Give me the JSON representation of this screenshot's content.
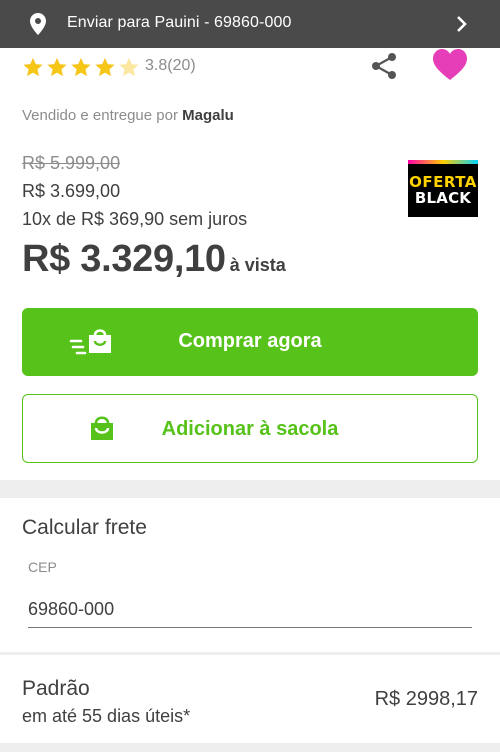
{
  "delivery_bar": {
    "text": "Enviar para Pauini - 69860-000"
  },
  "rating": {
    "value": 3.8,
    "stars_filled": 4,
    "text": "3.8(20)"
  },
  "seller": {
    "prefix": "Vendido e entregue por",
    "name": "Magalu"
  },
  "prices": {
    "old": "R$ 5.999,00",
    "current": "R$ 3.699,00",
    "installments": "10x de R$ 369,90 sem juros",
    "cash_value": "R$ 3.329,10",
    "cash_suffix": "à vista"
  },
  "badge": {
    "line1": "OFERTA",
    "line2": "BLACK"
  },
  "buttons": {
    "buy": "Comprar agora",
    "add_to_bag": "Adicionar à sacola"
  },
  "shipping": {
    "title": "Calcular frete",
    "cep_label": "CEP",
    "cep_value": "69860-000",
    "option_name": "Padrão",
    "option_time": "em até 55 dias úteis*",
    "option_price": "R$ 2998,17"
  },
  "colors": {
    "green": "#56c21a",
    "heart": "#e63db8",
    "star": "#f5c518",
    "topbar": "#4a4a4a"
  },
  "icons": {
    "location": "location-pin-icon",
    "chevron": "chevron-right-icon",
    "share": "share-icon",
    "favorite": "heart-icon",
    "bag": "shopping-bag-icon"
  }
}
